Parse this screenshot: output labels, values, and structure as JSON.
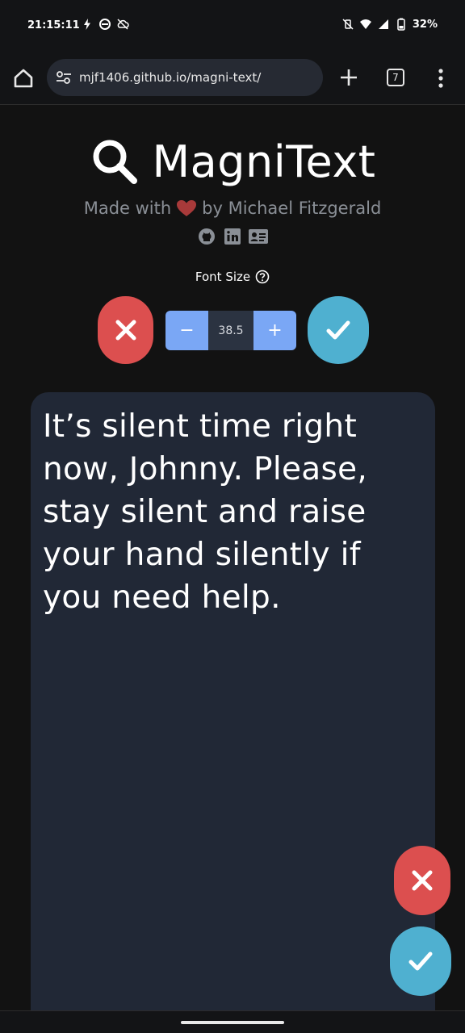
{
  "status_bar": {
    "time": "21:15:11",
    "battery": "32%",
    "left_icons": [
      "bolt-icon",
      "sync-icon",
      "cloud-off-icon"
    ],
    "right_icons": [
      "vibrate-off-icon",
      "wifi-icon",
      "signal-icon",
      "battery-icon"
    ]
  },
  "browser": {
    "url": "mjf1406.github.io/magni-text/",
    "tab_count": "7",
    "icons": [
      "home-icon",
      "tune-icon",
      "plus-icon",
      "tabs-icon",
      "more-vert-icon"
    ]
  },
  "header": {
    "title": "MagniText",
    "made_with_prefix": "Made with",
    "made_with_suffix": "by Michael Fitzgerald",
    "social": [
      "github-icon",
      "linkedin-icon",
      "contact-card-icon"
    ]
  },
  "controls": {
    "font_size_label": "Font Size",
    "decrement_label": "−",
    "increment_label": "+",
    "font_size_value": "38.5"
  },
  "text_area": {
    "content": "It’s silent time right now, Johnny. Please, stay silent and raise your hand silently if you need help."
  },
  "colors": {
    "background": "#121212",
    "panel": "#212836",
    "cancel": "#dc4f4f",
    "confirm": "#4fb0d0",
    "stepper": "#7aa7f5",
    "heart": "#a83a3a"
  }
}
